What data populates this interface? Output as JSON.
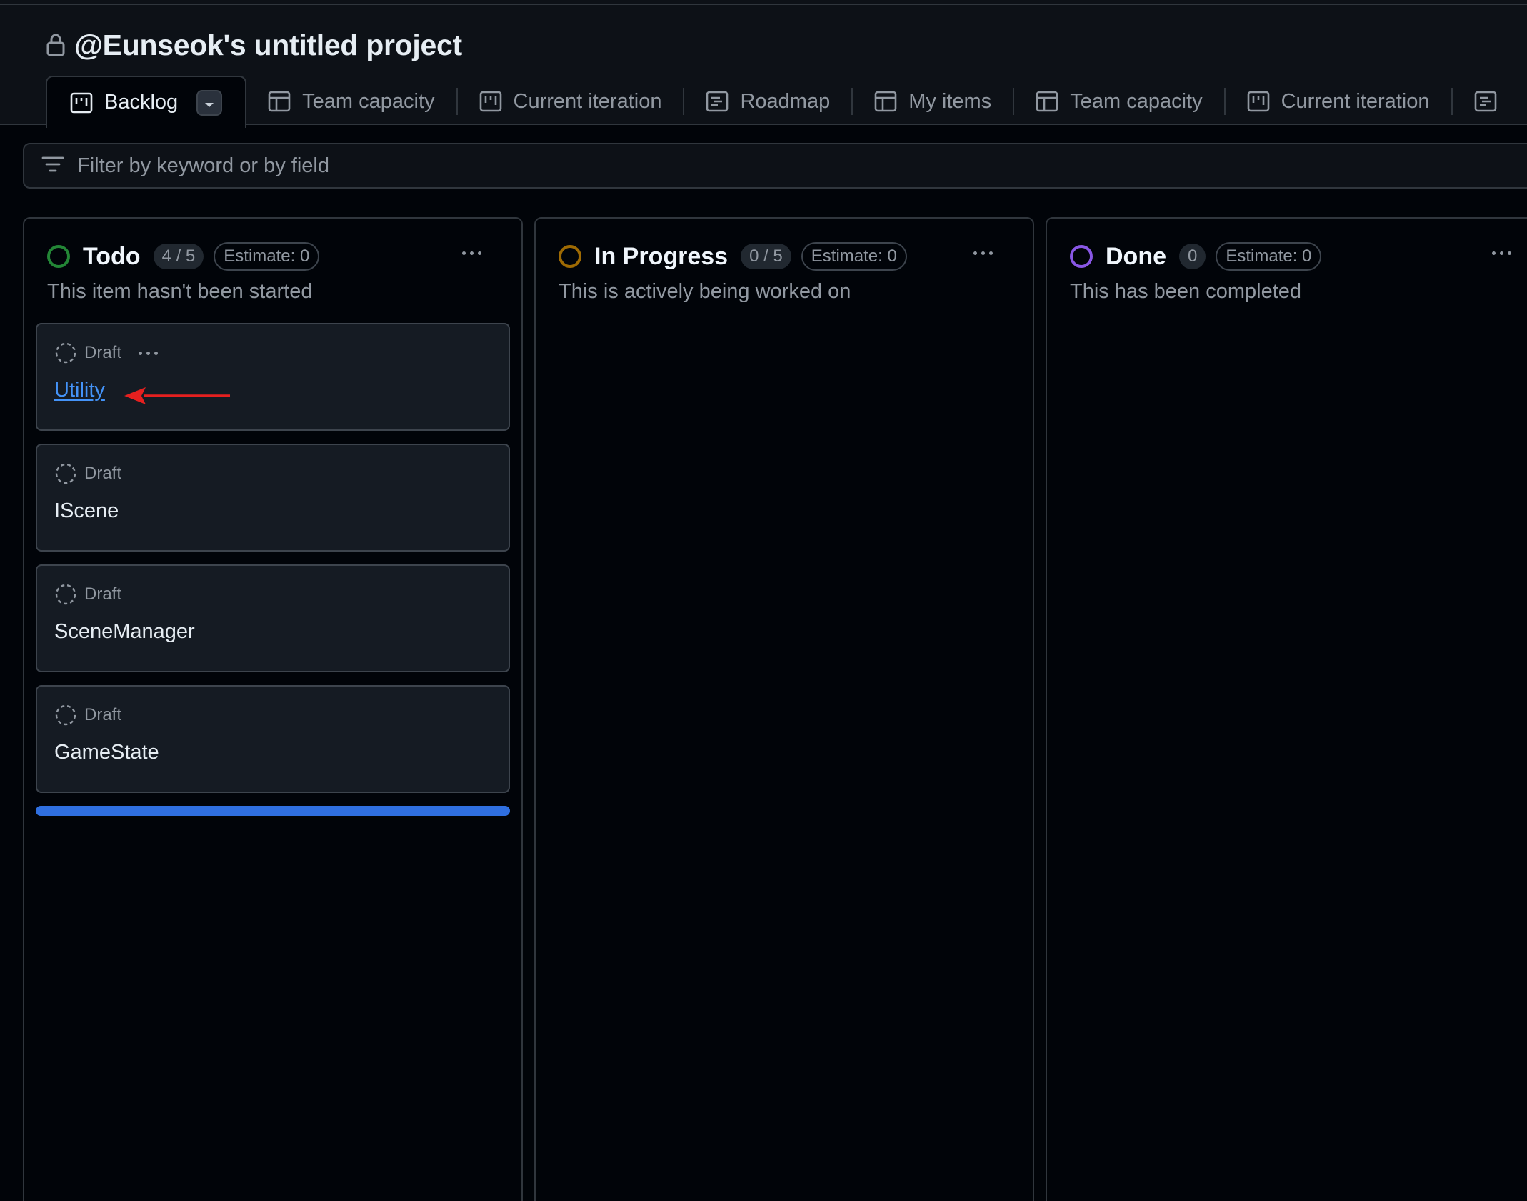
{
  "project": {
    "title": "@Eunseok's untitled project"
  },
  "tabs": [
    {
      "label": "Backlog",
      "icon": "board-icon",
      "active": true
    },
    {
      "label": "Team capacity",
      "icon": "table-icon"
    },
    {
      "label": "Current iteration",
      "icon": "board-icon"
    },
    {
      "label": "Roadmap",
      "icon": "roadmap-icon"
    },
    {
      "label": "My items",
      "icon": "table-icon"
    },
    {
      "label": "Team capacity",
      "icon": "table-icon"
    },
    {
      "label": "Current iteration",
      "icon": "board-icon"
    }
  ],
  "filter": {
    "placeholder": "Filter by keyword or by field"
  },
  "columns": [
    {
      "name": "Todo",
      "count": "4 / 5",
      "estimate": "Estimate: 0",
      "description": "This item hasn't been started",
      "color": "#238636",
      "cards": [
        {
          "status": "Draft",
          "title": "Utility"
        },
        {
          "status": "Draft",
          "title": "IScene"
        },
        {
          "status": "Draft",
          "title": "SceneManager"
        },
        {
          "status": "Draft",
          "title": "GameState"
        }
      ]
    },
    {
      "name": "In Progress",
      "count": "0 / 5",
      "estimate": "Estimate: 0",
      "description": "This is actively being worked on",
      "color": "#9e6a03"
    },
    {
      "name": "Done",
      "count": "0",
      "estimate": "Estimate: 0",
      "description": "This has been completed",
      "color": "#8957e5"
    }
  ],
  "colors": {
    "background": "#010409",
    "accent_link": "#4493f8",
    "annotation_arrow": "#e5201f",
    "add_bar": "#2f6fe0"
  }
}
